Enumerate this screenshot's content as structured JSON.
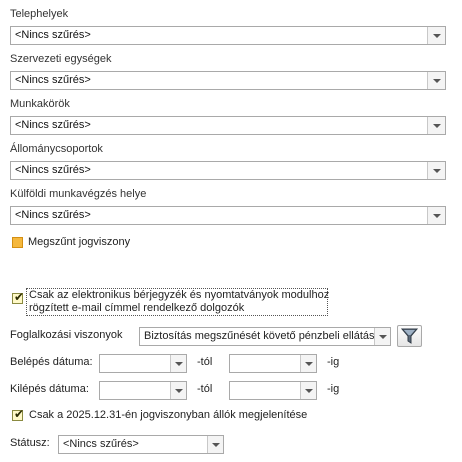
{
  "filters": [
    {
      "label": "Telephelyek",
      "value": "<Nincs szűrés>"
    },
    {
      "label": "Szervezeti egységek",
      "value": "<Nincs szűrés>"
    },
    {
      "label": "Munkakörök",
      "value": "<Nincs szűrés>"
    },
    {
      "label": "Állománycsoportok",
      "value": "<Nincs szűrés>"
    },
    {
      "label": "Külföldi munkavégzés helye",
      "value": "<Nincs szűrés>"
    }
  ],
  "megszunt_label": "Megszűnt jogviszony",
  "elektronikus_line1": "Csak az elektronikus bérjegyzék és nyomtatványok modulhoz",
  "elektronikus_line2": "rögzített e-mail címmel rendelkező dolgozók",
  "foglalkozasi_label": "Foglalkozási viszonyok",
  "foglalkozasi_value": "Biztosítás megszűnését követő pénzbeli ellátás;I",
  "belepes_label": "Belépés dátuma:",
  "kilepes_label": "Kilépés dátuma:",
  "tol": "-tól",
  "ig": "-ig",
  "jogviszony_label": "Csak a 2025.12.31-én jogviszonyban állók megjelenítése",
  "statusz_label": "Státusz:",
  "statusz_value": "<Nincs szűrés>",
  "icons": {
    "dropdown": "chevron-down-icon",
    "filter": "funnel-icon"
  }
}
